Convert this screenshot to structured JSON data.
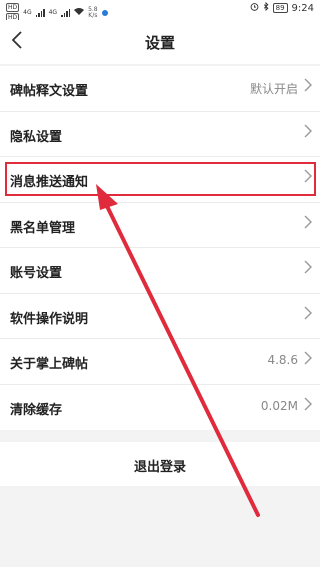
{
  "status_bar": {
    "net_badge_1": "HD",
    "net_badge_2": "HD",
    "gen_1": "4G",
    "gen_2": "4G",
    "speed_value": "5.8",
    "speed_unit": "K/s",
    "battery": "89",
    "time": "9:24"
  },
  "nav": {
    "back_icon": "chevron-left-icon",
    "title": "设置"
  },
  "settings": [
    {
      "label": "碑帖释文设置",
      "value": "默认开启"
    },
    {
      "label": "隐私设置",
      "value": ""
    },
    {
      "label": "消息推送通知",
      "value": ""
    },
    {
      "label": "黑名单管理",
      "value": ""
    },
    {
      "label": "账号设置",
      "value": ""
    },
    {
      "label": "软件操作说明",
      "value": ""
    },
    {
      "label": "关于掌上碑帖",
      "value": "4.8.6"
    },
    {
      "label": "清除缓存",
      "value": "0.02M"
    }
  ],
  "logout_label": "退出登录",
  "annotation": {
    "highlight_color": "#e02b3c",
    "arrow_color": "#e02b3c"
  }
}
